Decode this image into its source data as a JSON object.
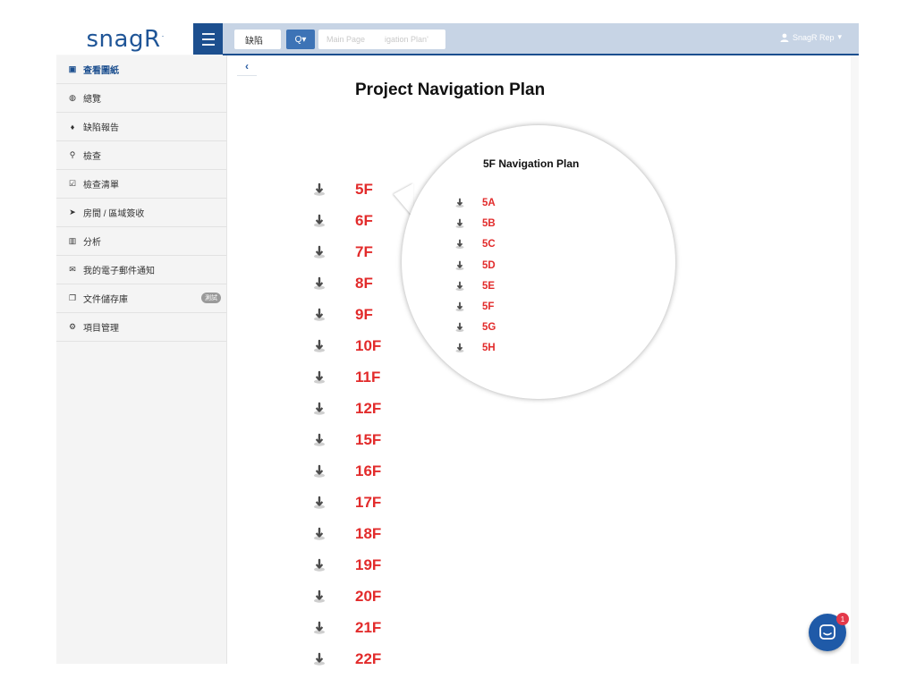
{
  "app": {
    "logo": "snagR",
    "logo_mark": "·"
  },
  "topbar": {
    "search_value": "缺陷",
    "search_button_label": "Q▾",
    "breadcrumb": [
      "Main Page",
      "igation Plan'"
    ],
    "user_label": "SnagR Rep"
  },
  "sidebar": {
    "items": [
      {
        "label": "查看圖紙",
        "icon": "image-icon"
      },
      {
        "label": "總覽",
        "icon": "dashboard-icon"
      },
      {
        "label": "缺陷報告",
        "icon": "map-marker-icon"
      },
      {
        "label": "檢查",
        "icon": "search-icon"
      },
      {
        "label": "檢查清單",
        "icon": "checklist-icon"
      },
      {
        "label": "房間 / 區域簽收",
        "icon": "send-icon"
      },
      {
        "label": "分析",
        "icon": "bar-chart-icon"
      },
      {
        "label": "我的電子郵件通知",
        "icon": "envelope-icon"
      },
      {
        "label": "文件儲存庫",
        "icon": "documents-icon",
        "badge": "測試"
      },
      {
        "label": "項目管理",
        "icon": "gears-icon"
      }
    ]
  },
  "main": {
    "back_label": "‹",
    "title": "Project Navigation Plan",
    "floors": [
      "5F",
      "6F",
      "7F",
      "8F",
      "9F",
      "10F",
      "11F",
      "12F",
      "15F",
      "16F",
      "17F",
      "18F",
      "19F",
      "20F",
      "21F",
      "22F"
    ]
  },
  "callout": {
    "title": "5F Navigation Plan",
    "items": [
      "5A",
      "5B",
      "5C",
      "5D",
      "5E",
      "5F",
      "5G",
      "5H"
    ]
  },
  "chat": {
    "unread": "1"
  },
  "colors": {
    "brand": "#1f5597",
    "header_bar": "#c7d4e5",
    "floor_link": "#e22b2b",
    "chat_button": "#1f5aa8",
    "chat_badge": "#e4394a"
  }
}
